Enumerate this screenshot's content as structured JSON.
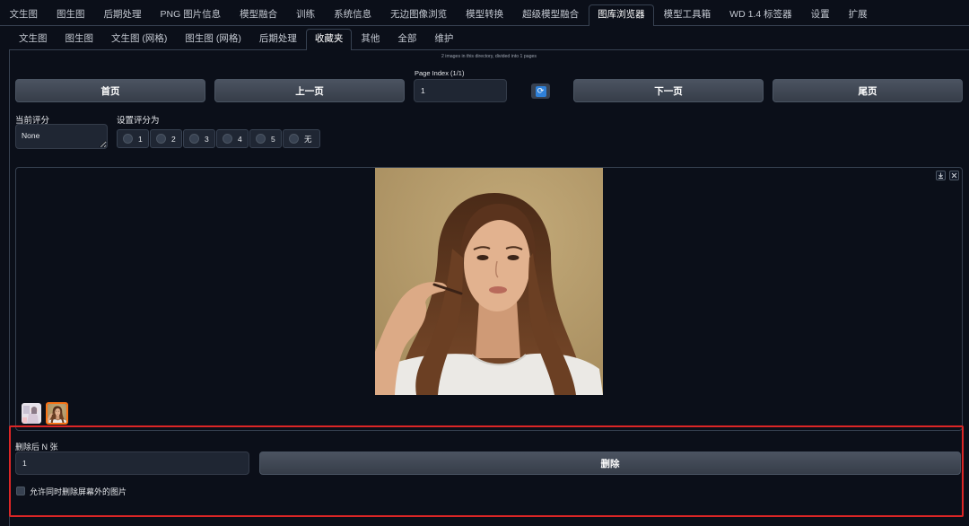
{
  "app": {
    "top_tabs": [
      "文生图",
      "图生图",
      "后期处理",
      "PNG 图片信息",
      "模型融合",
      "训练",
      "系统信息",
      "无边图像浏览",
      "模型转换",
      "超级模型融合",
      "图库浏览器",
      "模型工具箱",
      "WD 1.4 标签器",
      "设置",
      "扩展"
    ],
    "active_top_tab_index": 10
  },
  "gallery_tabs": {
    "items": [
      "文生图",
      "图生图",
      "文生图 (网格)",
      "图生图 (网格)",
      "后期处理",
      "收藏夹",
      "其他",
      "全部",
      "维护"
    ],
    "active_index": 5
  },
  "paging": {
    "directory_info": "2 images in this directory, divided into 1 pages",
    "page_index_label": "Page Index (1/1)",
    "page_index_value": "1",
    "first_button": "首页",
    "prev_button": "上一页",
    "next_button": "下一页",
    "last_button": "尾页",
    "refresh_icon": "refresh-icon"
  },
  "rating": {
    "current_label": "当前评分",
    "current_value": "None",
    "set_label": "设置评分为",
    "options": [
      "1",
      "2",
      "3",
      "4",
      "5",
      "无"
    ]
  },
  "gallery": {
    "toolbar_icons": [
      "download-icon",
      "close-icon"
    ],
    "selected_thumbnail_index": 1
  },
  "delete_panel": {
    "count_label": "删除后 N 张",
    "count_value": "1",
    "delete_button": "删除",
    "offscreen_checkbox_label": "允许同时删除屏幕外的图片",
    "offscreen_checkbox_checked": false
  },
  "colors": {
    "background": "#0b0f19",
    "border": "#374151",
    "selected_thumbnail": "#f97316",
    "highlight_box": "#dc2626",
    "refresh_icon": "#2f80d8"
  }
}
